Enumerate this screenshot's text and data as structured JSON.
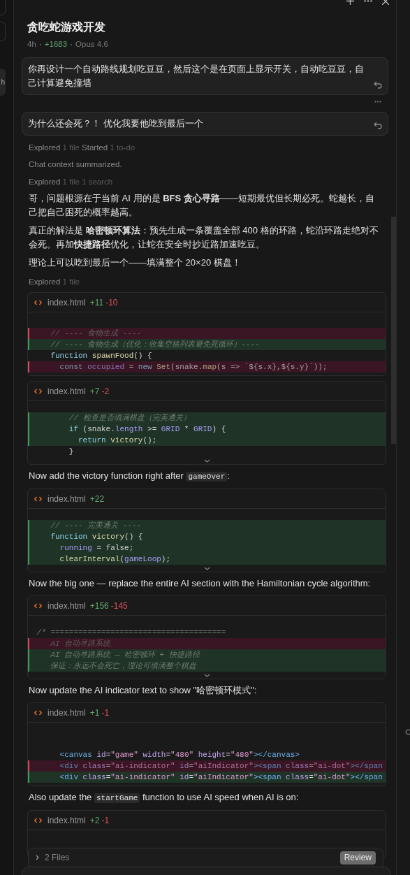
{
  "sidebar": {
    "items": [
      {
        "selected": false
      },
      {
        "selected": false
      },
      {
        "label": "h",
        "selected": true
      }
    ]
  },
  "chat": {
    "title": "贪吃蛇游戏开发",
    "meta": {
      "age": "4h",
      "added": "+1683",
      "model": "Opus 4.6"
    }
  },
  "messages": [
    {
      "kind": "user",
      "text": "你再设计一个自动路线规划吃豆豆，然后这个是在页面上显示开关，自动吃豆豆，自己计算避免撞墙",
      "more": true
    },
    {
      "kind": "user",
      "text": "为什么还会死？！ 优化我要他吃到最后一个",
      "more": false
    },
    {
      "kind": "status",
      "parts": [
        "Explored",
        "1 file",
        "Started",
        "1 to-do"
      ]
    },
    {
      "kind": "note",
      "text": "Chat context summarized."
    },
    {
      "kind": "status",
      "parts": [
        "Explored",
        "1 file 1 search"
      ]
    },
    {
      "kind": "paragraph",
      "text": "哥，问题根源在于当前 AI 用的是 **BFS 贪心寻路**——短期最优但长期必死。蛇越长，自己把自己困死的概率越高。"
    },
    {
      "kind": "paragraph",
      "text": "真正的解法是 **哈密顿环算法**：预先生成一条覆盖全部 400 格的环路，蛇沿环路走绝对不会死。再加**快捷路径**优化，让蛇在安全时抄近路加速吃豆。"
    },
    {
      "kind": "paragraph",
      "text": "理论上可以吃到最后一个——填满整个 20×20 棋盘！"
    },
    {
      "kind": "status",
      "parts": [
        "Explored",
        "1 file"
      ]
    },
    {
      "kind": "diff",
      "file": "index.html",
      "added": "+11",
      "removed": "-10",
      "expandable": false,
      "lines": [
        {
          "kind": "removed",
          "tokens": [
            {
              "kind": "comment",
              "text": "    // ---- 食物生成 ----"
            }
          ]
        },
        {
          "kind": "added",
          "tokens": [
            {
              "kind": "comment",
              "text": "    // ---- 食物生成（优化：收集空格列表避免死循环）----"
            }
          ]
        },
        {
          "kind": "context",
          "tokens": [
            {
              "kind": "keyword",
              "text": "    function"
            },
            {
              "kind": "function",
              "text": " spawnFood"
            },
            {
              "kind": "plain",
              "text": "() {"
            }
          ]
        },
        {
          "kind": "removed",
          "tokens": [
            {
              "kind": "keyword",
              "text": "      const"
            },
            {
              "kind": "variable",
              "text": " occupied"
            },
            {
              "kind": "plain",
              "text": " = "
            },
            {
              "kind": "keyword",
              "text": "new"
            },
            {
              "kind": "function",
              "text": " Set"
            },
            {
              "kind": "plain",
              "text": "(snake."
            },
            {
              "kind": "function",
              "text": "map"
            },
            {
              "kind": "plain",
              "text": "(s => `${s.x},${s.y}`));"
            }
          ]
        }
      ]
    },
    {
      "kind": "diff",
      "file": "index.html",
      "added": "+7",
      "removed": "-2",
      "expandable": true,
      "lines": [
        {
          "kind": "added",
          "tokens": [
            {
              "kind": "comment",
              "text": "        // 检查是否填满棋盘（完美通关）"
            }
          ]
        },
        {
          "kind": "added",
          "tokens": [
            {
              "kind": "keyword",
              "text": "        if"
            },
            {
              "kind": "plain",
              "text": " (snake."
            },
            {
              "kind": "variable",
              "text": "length"
            },
            {
              "kind": "plain",
              "text": " >= "
            },
            {
              "kind": "variable",
              "text": "GRID"
            },
            {
              "kind": "plain",
              "text": " * "
            },
            {
              "kind": "variable",
              "text": "GRID"
            },
            {
              "kind": "plain",
              "text": ") {"
            }
          ]
        },
        {
          "kind": "added",
          "tokens": [
            {
              "kind": "keyword",
              "text": "          return"
            },
            {
              "kind": "function",
              "text": " victory"
            },
            {
              "kind": "plain",
              "text": "();"
            }
          ]
        },
        {
          "kind": "context",
          "tokens": [
            {
              "kind": "plain",
              "text": "        }"
            }
          ]
        }
      ]
    },
    {
      "kind": "paragraph",
      "segments": [
        {
          "text": "Now add the victory function right after "
        },
        {
          "code": "gameOver"
        },
        {
          "text": ":"
        }
      ]
    },
    {
      "kind": "diff",
      "file": "index.html",
      "added": "+22",
      "expandable": true,
      "lines": [
        {
          "kind": "added",
          "tokens": [
            {
              "kind": "comment",
              "text": "    // ---- 完美通关 ----"
            }
          ]
        },
        {
          "kind": "added",
          "tokens": [
            {
              "kind": "keyword",
              "text": "    function"
            },
            {
              "kind": "function",
              "text": " victory"
            },
            {
              "kind": "plain",
              "text": "() {"
            }
          ]
        },
        {
          "kind": "added",
          "tokens": [
            {
              "kind": "variable",
              "text": "      running"
            },
            {
              "kind": "plain",
              "text": " = false;"
            }
          ]
        },
        {
          "kind": "added",
          "tokens": [
            {
              "kind": "function",
              "text": "      clearInterval"
            },
            {
              "kind": "plain",
              "text": "("
            },
            {
              "kind": "variable",
              "text": "gameLoop"
            },
            {
              "kind": "plain",
              "text": ");"
            }
          ]
        }
      ]
    },
    {
      "kind": "paragraph",
      "text": "Now the big one — replace the entire AI section with the Hamiltonian cycle algorithm:"
    },
    {
      "kind": "diff",
      "file": "index.html",
      "added": "+156",
      "removed": "-145",
      "expandable": true,
      "lines": [
        {
          "kind": "context",
          "tokens": [
            {
              "kind": "comment",
              "text": " /* ======================================"
            }
          ]
        },
        {
          "kind": "removed",
          "tokens": [
            {
              "kind": "comment",
              "text": "    AI 自动寻路系统"
            }
          ]
        },
        {
          "kind": "added",
          "tokens": [
            {
              "kind": "comment",
              "text": "    AI 自动寻路系统 — 哈密顿环 + 快捷路径"
            }
          ]
        },
        {
          "kind": "added",
          "tokens": [
            {
              "kind": "comment",
              "text": "    保证：永远不会死亡，理论可填满整个棋盘"
            }
          ]
        }
      ]
    },
    {
      "kind": "paragraph",
      "text": "Now update the AI indicator text to show \"哈密顿环模式\":"
    },
    {
      "kind": "diff",
      "file": "index.html",
      "added": "+1",
      "removed": "-1",
      "expandable": false,
      "lines": [
        {
          "kind": "context",
          "tokens": [
            {
              "kind": "tag",
              "text": "      <canvas"
            },
            {
              "kind": "attribute",
              "text": " id"
            },
            {
              "kind": "plain",
              "text": "="
            },
            {
              "kind": "string",
              "text": "\"game\""
            },
            {
              "kind": "attribute",
              "text": " width"
            },
            {
              "kind": "plain",
              "text": "="
            },
            {
              "kind": "string",
              "text": "\"480\""
            },
            {
              "kind": "attribute",
              "text": " height"
            },
            {
              "kind": "plain",
              "text": "="
            },
            {
              "kind": "string",
              "text": "\"480\""
            },
            {
              "kind": "tag",
              "text": "></canvas>"
            }
          ]
        },
        {
          "kind": "removed",
          "tokens": [
            {
              "kind": "tag",
              "text": "      <div"
            },
            {
              "kind": "attribute",
              "text": " class"
            },
            {
              "kind": "plain",
              "text": "="
            },
            {
              "kind": "string",
              "text": "\"ai-indicator\""
            },
            {
              "kind": "attribute",
              "text": " id"
            },
            {
              "kind": "plain",
              "text": "="
            },
            {
              "kind": "string",
              "text": "\"aiIndicator\""
            },
            {
              "kind": "tag",
              "text": "><span"
            },
            {
              "kind": "attribute",
              "text": " class"
            },
            {
              "kind": "plain",
              "text": "="
            },
            {
              "kind": "string",
              "text": "\"ai-dot\""
            },
            {
              "kind": "tag",
              "text": "></span"
            }
          ]
        },
        {
          "kind": "added",
          "tokens": [
            {
              "kind": "tag",
              "text": "      <div"
            },
            {
              "kind": "attribute",
              "text": " class"
            },
            {
              "kind": "plain",
              "text": "="
            },
            {
              "kind": "string",
              "text": "\"ai-indicator\""
            },
            {
              "kind": "attribute",
              "text": " id"
            },
            {
              "kind": "plain",
              "text": "="
            },
            {
              "kind": "string",
              "text": "\"aiIndicator\""
            },
            {
              "kind": "tag",
              "text": "><span"
            },
            {
              "kind": "attribute",
              "text": " class"
            },
            {
              "kind": "plain",
              "text": "="
            },
            {
              "kind": "string",
              "text": "\"ai-dot\""
            },
            {
              "kind": "tag",
              "text": "></span"
            }
          ]
        }
      ]
    },
    {
      "kind": "paragraph",
      "segments": [
        {
          "text": "Also update the "
        },
        {
          "code": "startGame"
        },
        {
          "text": " function to use AI speed when AI is on:"
        }
      ]
    },
    {
      "kind": "diff",
      "file": "index.html",
      "added": "+2",
      "removed": "-1",
      "expandable": false
    }
  ],
  "files_bar": {
    "label": "2 Files",
    "button": "Review"
  }
}
